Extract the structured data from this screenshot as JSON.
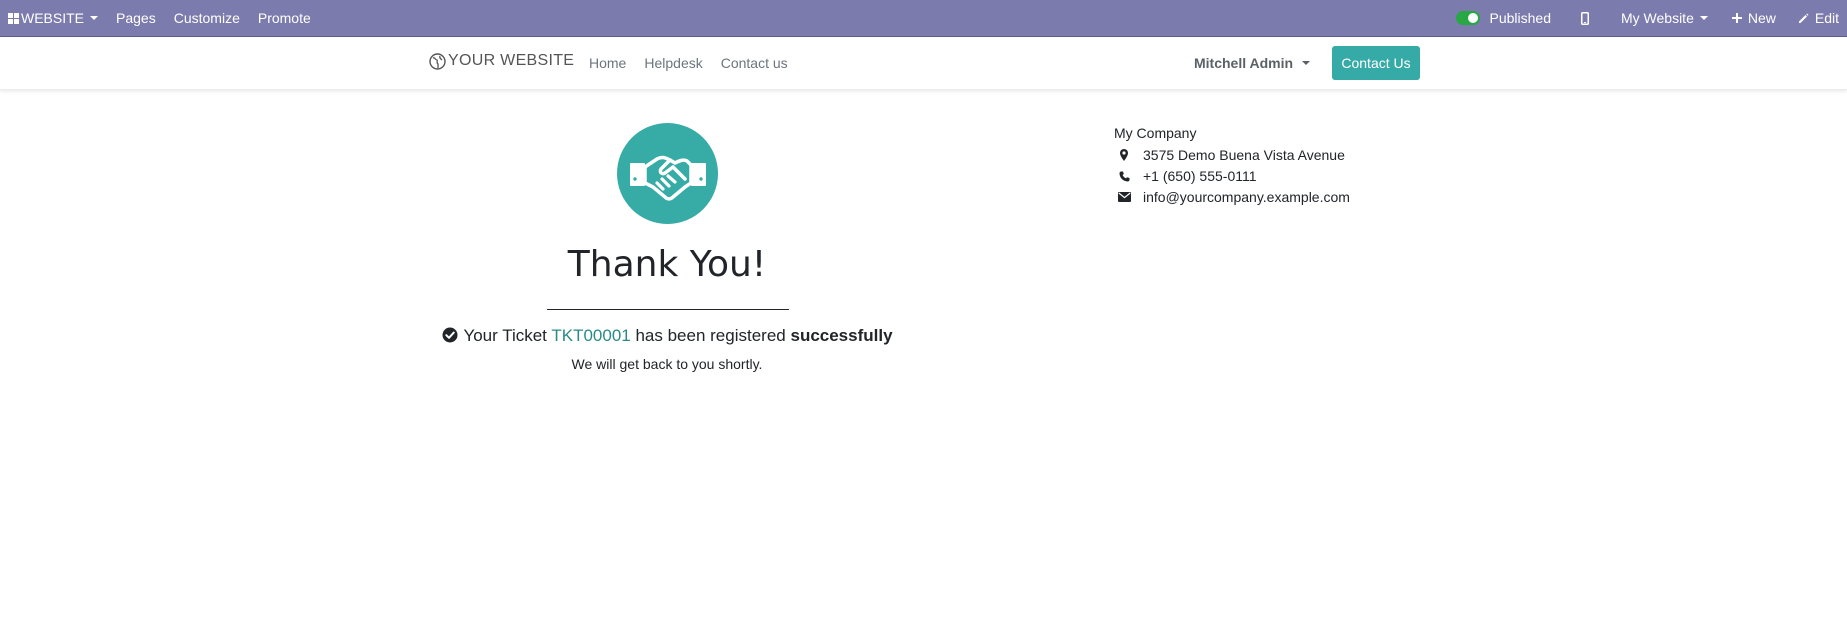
{
  "admin_bar": {
    "app_label": "WEBSITE",
    "menu": [
      "Pages",
      "Customize",
      "Promote"
    ],
    "published_label": "Published",
    "website_label": "My Website",
    "new_label": "New",
    "edit_label": "Edit",
    "icons": [
      "apps-grid-icon",
      "mobile-preview-icon",
      "plus-icon",
      "pencil-icon"
    ]
  },
  "header": {
    "brand": "YOUR WEBSITE",
    "nav": [
      "Home",
      "Helpdesk",
      "Contact us"
    ],
    "user_name": "Mitchell Admin",
    "cta_label": "Contact Us",
    "accent_color": "#36aaa6"
  },
  "main": {
    "title": "Thank You!",
    "ticket_prefix": "Your Ticket",
    "ticket_id": "TKT00001",
    "ticket_middle": "has been registered",
    "ticket_emphasis": "successfully",
    "subtitle": "We will get back to you shortly.",
    "hero_icon": "handshake-icon"
  },
  "company": {
    "name": "My Company",
    "address": "3575 Demo Buena Vista Avenue",
    "phone": "+1 (650) 555-0111",
    "email": "info@yourcompany.example.com"
  }
}
